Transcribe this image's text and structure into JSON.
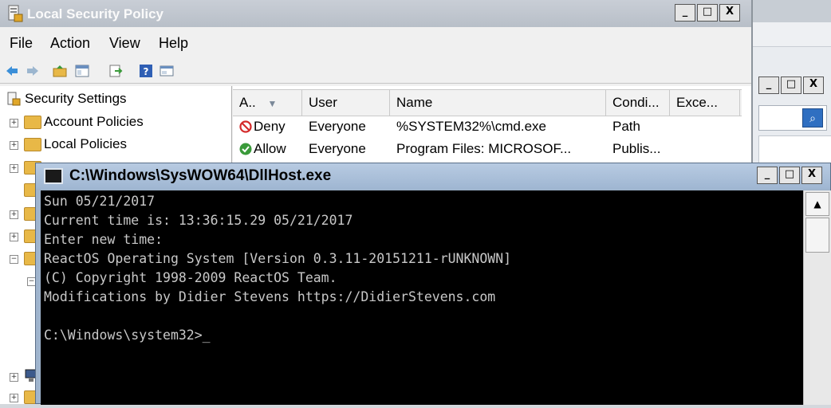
{
  "lsp": {
    "title": "Local Security Policy",
    "menu": [
      "File",
      "Action",
      "View",
      "Help"
    ],
    "tree": {
      "root": "Security Settings",
      "items": [
        "Account Policies",
        "Local Policies"
      ]
    },
    "list": {
      "columns": [
        "A..",
        "User",
        "Name",
        "Condi...",
        "Exce..."
      ],
      "sort_glyph": "▼",
      "rows": [
        {
          "action": "Deny",
          "user": "Everyone",
          "name": "%SYSTEM32%\\cmd.exe",
          "condition": "Path",
          "exceptions": ""
        },
        {
          "action": "Allow",
          "user": "Everyone",
          "name": "Program Files: MICROSOF...",
          "condition": "Publis...",
          "exceptions": ""
        }
      ]
    }
  },
  "console": {
    "title": "C:\\Windows\\SysWOW64\\DllHost.exe",
    "lines": [
      "Sun 05/21/2017",
      "Current time is: 13:36:15.29 05/21/2017",
      "Enter new time:",
      "ReactOS Operating System [Version 0.3.11-20151211-rUNKNOWN]",
      "(C) Copyright 1998-2009 ReactOS Team.",
      "Modifications by Didier Stevens https://DidierStevens.com",
      "",
      "C:\\Windows\\system32>_"
    ]
  },
  "window_buttons": {
    "minimize": "_",
    "maximize": "□",
    "close": "X"
  },
  "colors": {
    "deny": "#d42a2a",
    "allow": "#3a9a3a",
    "console_bg": "#000000",
    "console_text": "#c8c8c8"
  }
}
